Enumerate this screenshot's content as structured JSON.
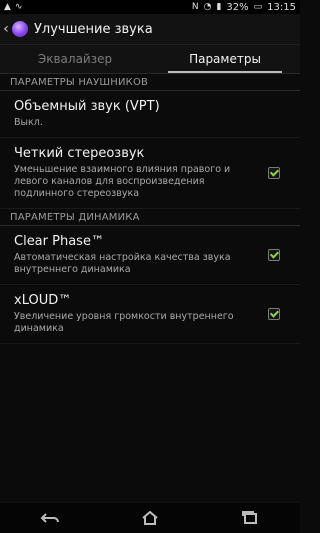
{
  "status": {
    "left_icons": [
      "warning-icon",
      "wave-icon"
    ],
    "right_icons": [
      "nfc-icon",
      "wifi-icon",
      "signal-icon"
    ],
    "battery": "32%",
    "time": "13:15"
  },
  "app": {
    "title": "Улучшение звука",
    "icon": "sound-enhance-icon"
  },
  "tabs": [
    {
      "label": "Эквалайзер",
      "active": false
    },
    {
      "label": "Параметры",
      "active": true
    }
  ],
  "sections": [
    {
      "header": "ПАРАМЕТРЫ НАУШНИКОВ",
      "items": [
        {
          "title": "Объемный звук (VPT)",
          "summary": "Выкл.",
          "checkbox": false
        },
        {
          "title": "Четкий стереозвук",
          "summary": "Уменьшение взаимного влияния правого и левого каналов для воспроизведения подлинного стереозвука",
          "checkbox": true,
          "checked": true
        }
      ]
    },
    {
      "header": "ПАРАМЕТРЫ ДИНАМИКА",
      "items": [
        {
          "title": "Clear Phase™",
          "summary": "Автоматическая настройка качества звука внутреннего динамика",
          "checkbox": true,
          "checked": true
        },
        {
          "title": "xLOUD™",
          "summary": "Увеличение уровня громкости внутреннего динамика",
          "checkbox": true,
          "checked": true
        }
      ]
    }
  ],
  "navbar": {
    "buttons": [
      "back-icon",
      "home-icon",
      "recent-apps-icon"
    ]
  }
}
